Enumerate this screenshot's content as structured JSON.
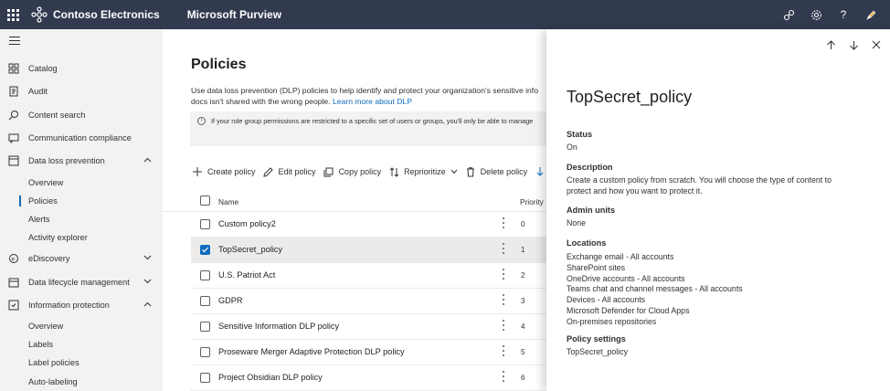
{
  "header": {
    "org_name": "Contoso Electronics",
    "app_name": "Microsoft Purview",
    "bg_color": "#323a4f",
    "icons": [
      "connector-icon",
      "settings-gear-icon",
      "help-icon",
      "pen-icon"
    ]
  },
  "nav": {
    "items": [
      {
        "label": "Catalog",
        "icon": "catalog-icon"
      },
      {
        "label": "Audit",
        "icon": "audit-icon"
      },
      {
        "label": "Content search",
        "icon": "search-icon"
      },
      {
        "label": "Communication compliance",
        "icon": "communication-icon"
      },
      {
        "label": "Data loss prevention",
        "icon": "dlp-icon",
        "expanded": true
      },
      {
        "label": "eDiscovery",
        "icon": "ediscovery-icon"
      },
      {
        "label": "Data lifecycle management",
        "icon": "lifecycle-icon"
      },
      {
        "label": "Information protection",
        "icon": "protection-icon",
        "expanded": true
      }
    ],
    "dlp_sub": [
      "Overview",
      "Policies",
      "Alerts",
      "Activity explorer"
    ],
    "ip_sub": [
      "Overview",
      "Labels",
      "Label policies",
      "Auto-labeling"
    ],
    "active_sub": "Policies"
  },
  "main": {
    "title": "Policies",
    "description_line1": "Use data loss prevention (DLP) policies to help identify and protect your organization's sensitive info",
    "description_line2": "docs isn't shared with the wrong people.",
    "learn_more": "Learn more about DLP",
    "info_text": "If your role group permissions are restricted to a specific set of users or groups, you'll only be able to manage",
    "toolbar": [
      {
        "label": "Create policy",
        "icon": "plus-icon"
      },
      {
        "label": "Edit policy",
        "icon": "edit-icon"
      },
      {
        "label": "Copy policy",
        "icon": "copy-icon"
      },
      {
        "label": "Reprioritize",
        "icon": "reprioritize-icon"
      },
      {
        "label": "Delete policy",
        "icon": "delete-icon"
      }
    ],
    "table": {
      "col_name": "Name",
      "col_priority": "Priority",
      "rows": [
        {
          "name": "Custom policy2",
          "priority": "0",
          "selected": false
        },
        {
          "name": "TopSecret_policy",
          "priority": "1",
          "selected": true
        },
        {
          "name": "U.S. Patriot Act",
          "priority": "2",
          "selected": false
        },
        {
          "name": "GDPR",
          "priority": "3",
          "selected": false
        },
        {
          "name": "Sensitive Information DLP policy",
          "priority": "4",
          "selected": false
        },
        {
          "name": "Proseware Merger Adaptive Protection DLP policy",
          "priority": "5",
          "selected": false
        },
        {
          "name": "Project Obsidian DLP policy",
          "priority": "6",
          "selected": false
        }
      ]
    }
  },
  "panel": {
    "title": "TopSecret_policy",
    "status_label": "Status",
    "status_value": "On",
    "description_label": "Description",
    "description_value": "Create a custom policy from scratch. You will choose the type of content to protect and how you want to protect it.",
    "admin_units_label": "Admin units",
    "admin_units_value": "None",
    "locations_label": "Locations",
    "locations": [
      "Exchange email - All accounts",
      "SharePoint sites",
      "OneDrive accounts - All accounts",
      "Teams chat and channel messages - All accounts",
      "Devices - All accounts",
      "Microsoft Defender for Cloud Apps",
      "On-premises repositories"
    ],
    "policy_settings_label": "Policy settings",
    "policy_settings_value": "TopSecret_policy"
  }
}
